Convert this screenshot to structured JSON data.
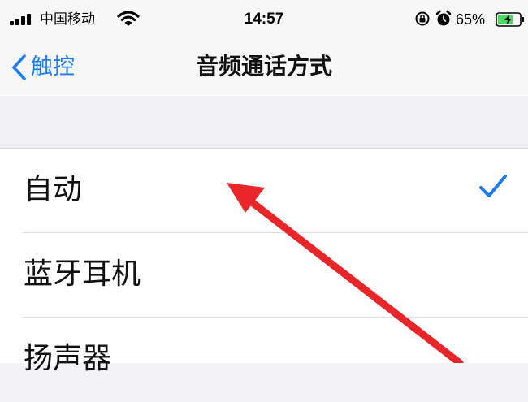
{
  "status_bar": {
    "carrier": "中国移动",
    "time": "14:57",
    "battery": "65%",
    "icons": [
      "signal-bars-icon",
      "wifi-icon",
      "rotation-lock-icon",
      "alarm-icon",
      "battery-charging-icon"
    ]
  },
  "nav": {
    "back_label": "触控",
    "title": "音频通话方式"
  },
  "options": [
    {
      "label": "自动",
      "selected": true
    },
    {
      "label": "蓝牙耳机",
      "selected": false
    },
    {
      "label": "扬声器",
      "selected": false
    }
  ],
  "colors": {
    "accent": "#1e7cf2",
    "annotation": "#e8262a",
    "background": "#f2f2f7"
  }
}
